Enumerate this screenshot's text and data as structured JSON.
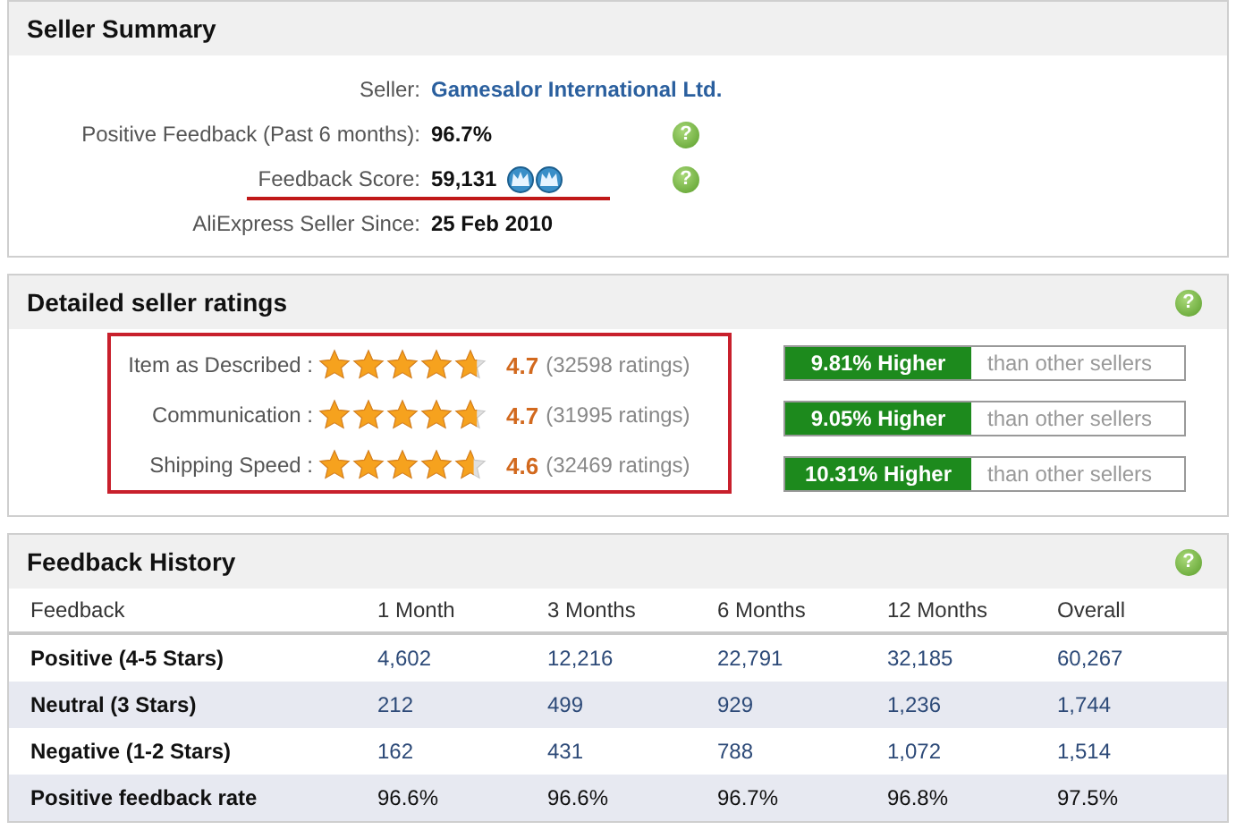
{
  "seller_summary": {
    "title": "Seller Summary",
    "rows": [
      {
        "label": "Seller:",
        "value": "Gamesalor International Ltd.",
        "kind": "link",
        "help": null,
        "underlined": false
      },
      {
        "label": "Positive Feedback (Past 6 months):",
        "value": "96.7%",
        "kind": "text",
        "help": "?",
        "underlined": false
      },
      {
        "label": "Feedback Score:",
        "value": "59,131",
        "kind": "text",
        "help": "?",
        "underlined": true,
        "badge": {
          "kind": "crowns"
        }
      },
      {
        "label": "AliExpress Seller Since:",
        "value": "25 Feb 2010",
        "kind": "text",
        "help": null,
        "underlined": false
      }
    ]
  },
  "detailed_ratings": {
    "title": "Detailed seller ratings",
    "help": "?",
    "highlighted": true,
    "rows": [
      {
        "label": "Item as Described :",
        "stars": 4.7,
        "score": "4.7",
        "count": "(32598 ratings)",
        "comparison": "9.81% Higher",
        "comparison_note": "than other sellers"
      },
      {
        "label": "Communication :",
        "stars": 4.7,
        "score": "4.7",
        "count": "(31995 ratings)",
        "comparison": "9.05% Higher",
        "comparison_note": "than other sellers"
      },
      {
        "label": "Shipping Speed :",
        "stars": 4.6,
        "score": "4.6",
        "count": "(32469 ratings)",
        "comparison": "10.31% Higher",
        "comparison_note": "than other sellers"
      }
    ]
  },
  "feedback_history": {
    "title": "Feedback History",
    "help": "?",
    "columns": [
      "Feedback",
      "1 Month",
      "3 Months",
      "6 Months",
      "12 Months",
      "Overall"
    ],
    "rows": [
      {
        "kind": "count",
        "cells": [
          "Positive (4-5 Stars)",
          "4,602",
          "12,216",
          "22,791",
          "32,185",
          "60,267"
        ]
      },
      {
        "kind": "count",
        "cells": [
          "Neutral (3 Stars)",
          "212",
          "499",
          "929",
          "1,236",
          "1,744"
        ]
      },
      {
        "kind": "count",
        "cells": [
          "Negative (1-2 Stars)",
          "162",
          "431",
          "788",
          "1,072",
          "1,514"
        ]
      },
      {
        "kind": "rate",
        "cells": [
          "Positive feedback rate",
          "96.6%",
          "96.6%",
          "96.7%",
          "96.8%",
          "97.5%"
        ]
      }
    ]
  }
}
